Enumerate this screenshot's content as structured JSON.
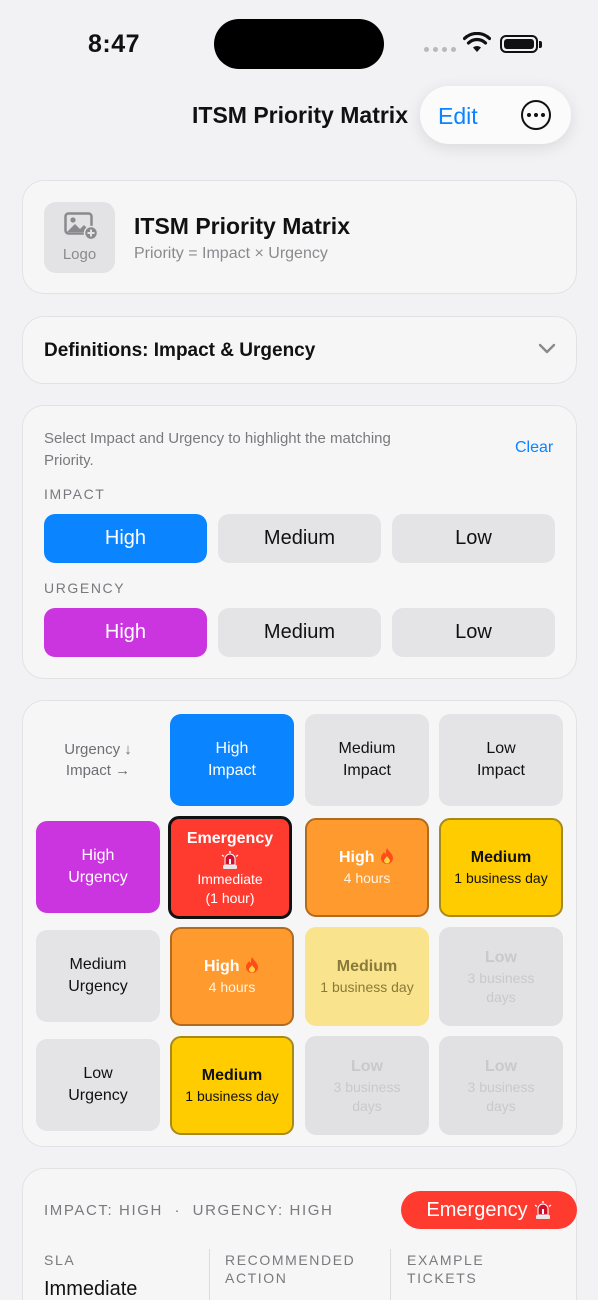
{
  "status_bar": {
    "time": "8:47"
  },
  "nav": {
    "title": "ITSM Priority Matrix",
    "edit_label": "Edit",
    "more_icon": "ellipsis-circle-icon"
  },
  "header": {
    "logo_label": "Logo",
    "title": "ITSM Priority Matrix",
    "subtitle": "Priority = Impact × Urgency"
  },
  "definitions": {
    "label": "Definitions: Impact & Urgency"
  },
  "selector": {
    "hint": "Select Impact and Urgency to highlight the matching Priority.",
    "clear_label": "Clear",
    "impact_label": "IMPACT",
    "urgency_label": "URGENCY",
    "impact_options": [
      "High",
      "Medium",
      "Low"
    ],
    "urgency_options": [
      "High",
      "Medium",
      "Low"
    ],
    "selected_impact": "High",
    "selected_urgency": "High"
  },
  "matrix": {
    "corner_line1": "Urgency ↓",
    "corner_line2": "Impact →",
    "col_headers": [
      {
        "line1": "High",
        "line2": "Impact"
      },
      {
        "line1": "Medium",
        "line2": "Impact"
      },
      {
        "line1": "Low",
        "line2": "Impact"
      }
    ],
    "row_headers": [
      {
        "line1": "High",
        "line2": "Urgency"
      },
      {
        "line1": "Medium",
        "line2": "Urgency"
      },
      {
        "line1": "Low",
        "line2": "Urgency"
      }
    ],
    "cells": [
      [
        {
          "title": "Emergency",
          "sub1": "Immediate",
          "sub2": "(1 hour)"
        },
        {
          "title": "High",
          "sub1": "4 hours"
        },
        {
          "title": "Medium",
          "sub1": "1 business day"
        }
      ],
      [
        {
          "title": "High",
          "sub1": "4 hours"
        },
        {
          "title": "Medium",
          "sub1": "1 business day"
        },
        {
          "title": "Low",
          "sub1": "3 business",
          "sub2": "days"
        }
      ],
      [
        {
          "title": "Medium",
          "sub1": "1 business day"
        },
        {
          "title": "Low",
          "sub1": "3 business",
          "sub2": "days"
        },
        {
          "title": "Low",
          "sub1": "3 business",
          "sub2": "days"
        }
      ]
    ]
  },
  "detail": {
    "impact_text": "IMPACT: HIGH",
    "separator": "·",
    "urgency_text": "URGENCY: HIGH",
    "badge_label": "Emergency",
    "col1_label": "SLA",
    "col2_label_line1": "RECOMMENDED",
    "col2_label_line2": "ACTION",
    "col3_label_line1": "EXAMPLE",
    "col3_label_line2": "TICKETS",
    "sla_value": "Immediate"
  },
  "colors": {
    "accent_blue": "#0a84ff",
    "urgency_purple": "#cb35e0",
    "emergency_red": "#ff3b30",
    "high_orange": "#ff9a2e",
    "medium_yellow": "#ffcc00"
  }
}
